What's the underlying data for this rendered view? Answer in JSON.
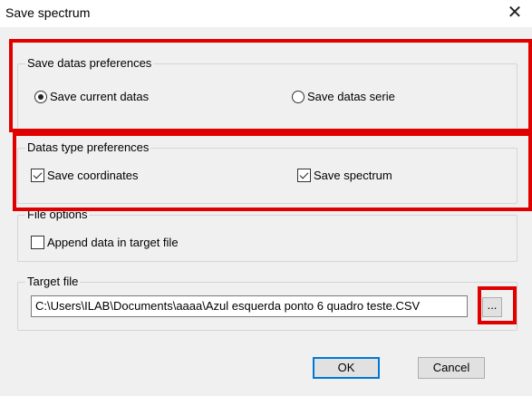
{
  "window": {
    "title": "Save spectrum",
    "close_glyph": "✕"
  },
  "save_datas_preferences": {
    "legend": "Save datas preferences",
    "options": [
      {
        "label": "Save current datas",
        "checked": true
      },
      {
        "label": "Save datas serie",
        "checked": false
      }
    ]
  },
  "datas_type_preferences": {
    "legend": "Datas type preferences",
    "options": [
      {
        "label": "Save coordinates",
        "checked": true
      },
      {
        "label": "Save spectrum",
        "checked": true
      }
    ]
  },
  "file_options": {
    "legend": "File options",
    "append_label": "Append data in target file",
    "append_checked": false
  },
  "target_file": {
    "legend": "Target file",
    "path": "C:\\Users\\ILAB\\Documents\\aaaa\\Azul esquerda ponto 6 quadro teste.CSV",
    "browse_label": "..."
  },
  "buttons": {
    "ok_label": "OK",
    "cancel_label": "Cancel"
  },
  "annotation_color": "#e00000"
}
